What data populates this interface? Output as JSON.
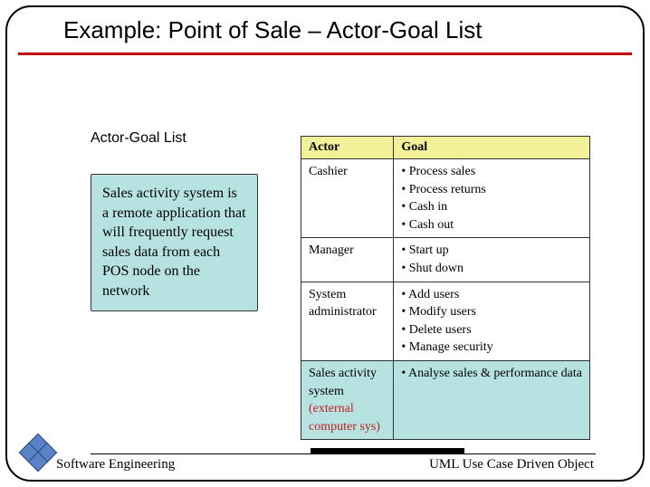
{
  "title": "Example: Point of Sale – Actor-Goal List",
  "subtitle": "Actor-Goal List",
  "note": "Sales activity system is a remote application that will frequently request sales data from each POS node on the network",
  "table": {
    "headers": {
      "actor": "Actor",
      "goal": "Goal"
    },
    "rows": [
      {
        "actor": "Cashier",
        "goals": [
          "Process sales",
          "Process returns",
          "Cash in",
          "Cash out"
        ],
        "highlight": false
      },
      {
        "actor": "Manager",
        "goals": [
          "Start up",
          "Shut down"
        ],
        "highlight": false
      },
      {
        "actor": "System administrator",
        "goals": [
          "Add users",
          "Modify users",
          "Delete users",
          "Manage security"
        ],
        "highlight": false
      },
      {
        "actor": "Sales activity system",
        "actor_ext": "(external computer sys)",
        "goals": [
          "Analyse sales & performance data"
        ],
        "highlight": true
      }
    ]
  },
  "footer": {
    "left": "Software Engineering",
    "right": "UML Use Case Driven Object"
  }
}
